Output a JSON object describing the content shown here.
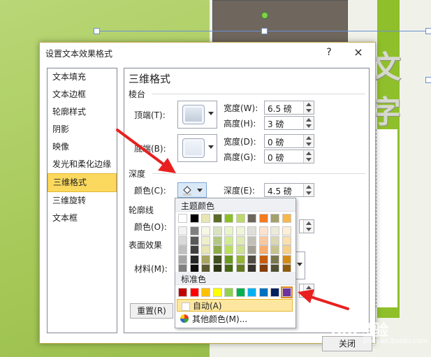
{
  "background": {
    "slide_text": "文字"
  },
  "dialog": {
    "title": "设置文本效果格式",
    "help": "?",
    "close": "×",
    "nav": [
      "文本填充",
      "文本边框",
      "轮廓样式",
      "阴影",
      "映像",
      "发光和柔化边缘",
      "三维格式",
      "三维旋转",
      "文本框"
    ],
    "active_nav": "三维格式",
    "panel": {
      "title": "三维格式",
      "bevel_section": "棱台",
      "top_label": "顶端(T):",
      "bottom_label": "底端(B):",
      "width_label_1": "宽度(W):",
      "height_label_1": "高度(H):",
      "width_label_2": "宽度(D):",
      "height_label_2": "高度(G):",
      "top_width": "6.5 磅",
      "top_height": "3 磅",
      "bottom_width": "0 磅",
      "bottom_height": "0 磅",
      "depth_section": "深度",
      "depth_color_label": "颜色(C):",
      "depth_label": "深度(E):",
      "depth_value": "4.5 磅",
      "contour_section": "轮廓线",
      "contour_color_label": "颜色(O):",
      "surface_section": "表面效果",
      "material_label": "材料(M):",
      "reset_label": "重置(R)"
    },
    "close_button": "关闭"
  },
  "color_dropdown": {
    "theme_header": "主题颜色",
    "standard_header": "标准色",
    "auto_label": "自动(A)",
    "more_label": "其他颜色(M)...",
    "theme_top_row": [
      "#ffffff",
      "#000000",
      "#e7e6b5",
      "#5a6b2a",
      "#8cbf26",
      "#bdd86b",
      "#6b655c",
      "#f47b20",
      "#a3a06b",
      "#f8b74a"
    ],
    "theme_shades": [
      [
        "#f2f2f2",
        "#7f7f7f",
        "#f7f7e6",
        "#d9e3c2",
        "#e8f5c8",
        "#eef5d9",
        "#e0ded9",
        "#fde3cf",
        "#ecebd9",
        "#fdefd6"
      ],
      [
        "#d9d9d9",
        "#595959",
        "#efefcd",
        "#b3c785",
        "#d2eb92",
        "#deebb4",
        "#c1beb6",
        "#fbc8a0",
        "#d9d7b4",
        "#fbdfad"
      ],
      [
        "#bfbfbf",
        "#3f3f3f",
        "#e7e6b5",
        "#8caa49",
        "#bbe05b",
        "#cde18f",
        "#a29e94",
        "#f8ac70",
        "#c6c38e",
        "#f9cf85"
      ],
      [
        "#a5a5a5",
        "#262626",
        "#a8a560",
        "#435020",
        "#6a9b1d",
        "#94b435",
        "#504c45",
        "#c55c0e",
        "#7a774e",
        "#d58b13"
      ],
      [
        "#7f7f7f",
        "#0c0c0c",
        "#5c5a30",
        "#2d3515",
        "#466713",
        "#627823",
        "#35322e",
        "#833d09",
        "#514f34",
        "#8e5c0d"
      ]
    ],
    "standard": [
      "#c00000",
      "#ff0000",
      "#ffc000",
      "#ffff00",
      "#92d050",
      "#00b050",
      "#00b0f0",
      "#0070c0",
      "#002060",
      "#7030a0"
    ],
    "selected_standard": 9
  },
  "watermark": {
    "brand": "Bai经验",
    "sub": "jingyan.baidu.com"
  }
}
